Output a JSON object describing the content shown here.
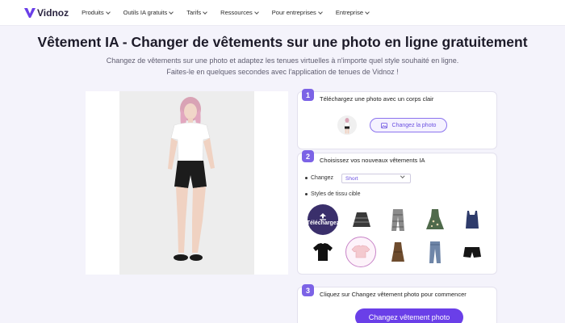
{
  "brand": {
    "name": "Vidnoz",
    "accent": "#6a3fe8"
  },
  "nav": {
    "items": [
      {
        "label": "Produits"
      },
      {
        "label": "Outils IA gratuits"
      },
      {
        "label": "Tarifs"
      },
      {
        "label": "Ressources"
      },
      {
        "label": "Pour entreprises"
      },
      {
        "label": "Entreprise"
      }
    ]
  },
  "hero": {
    "title": "Vêtement IA - Changer de vêtements sur une photo en ligne gratuitement",
    "subtitle_line1": "Changez de vêtements sur une photo et adaptez les tenues virtuelles à n'importe quel style souhaité en ligne.",
    "subtitle_line2": "Faites-le en quelques secondes avec l'application de tenues de Vidnoz !"
  },
  "step1": {
    "number": "1",
    "title": "Téléchargez une photo avec un corps clair",
    "button_label": "Changez la photo"
  },
  "step2": {
    "number": "2",
    "title": "Choisissez vos nouveaux vêtements IA",
    "change_label": "Changez",
    "select_value": "Short",
    "styles_label": "Styles de tissu cible",
    "upload_label": "Téléchargez",
    "garments": [
      {
        "icon": "skirt-icon"
      },
      {
        "icon": "plaid-pants-icon"
      },
      {
        "icon": "floral-dress-icon"
      },
      {
        "icon": "navy-camisole-icon"
      },
      {
        "icon": "black-tshirt-icon"
      },
      {
        "icon": "pink-crop-top-icon"
      },
      {
        "icon": "brown-dress-icon"
      },
      {
        "icon": "jeans-icon"
      },
      {
        "icon": "black-shorts-icon"
      }
    ]
  },
  "step3": {
    "number": "3",
    "title": "Cliquez sur Changez vêtement photo pour commencer",
    "button_label": "Changez vêtement photo"
  }
}
